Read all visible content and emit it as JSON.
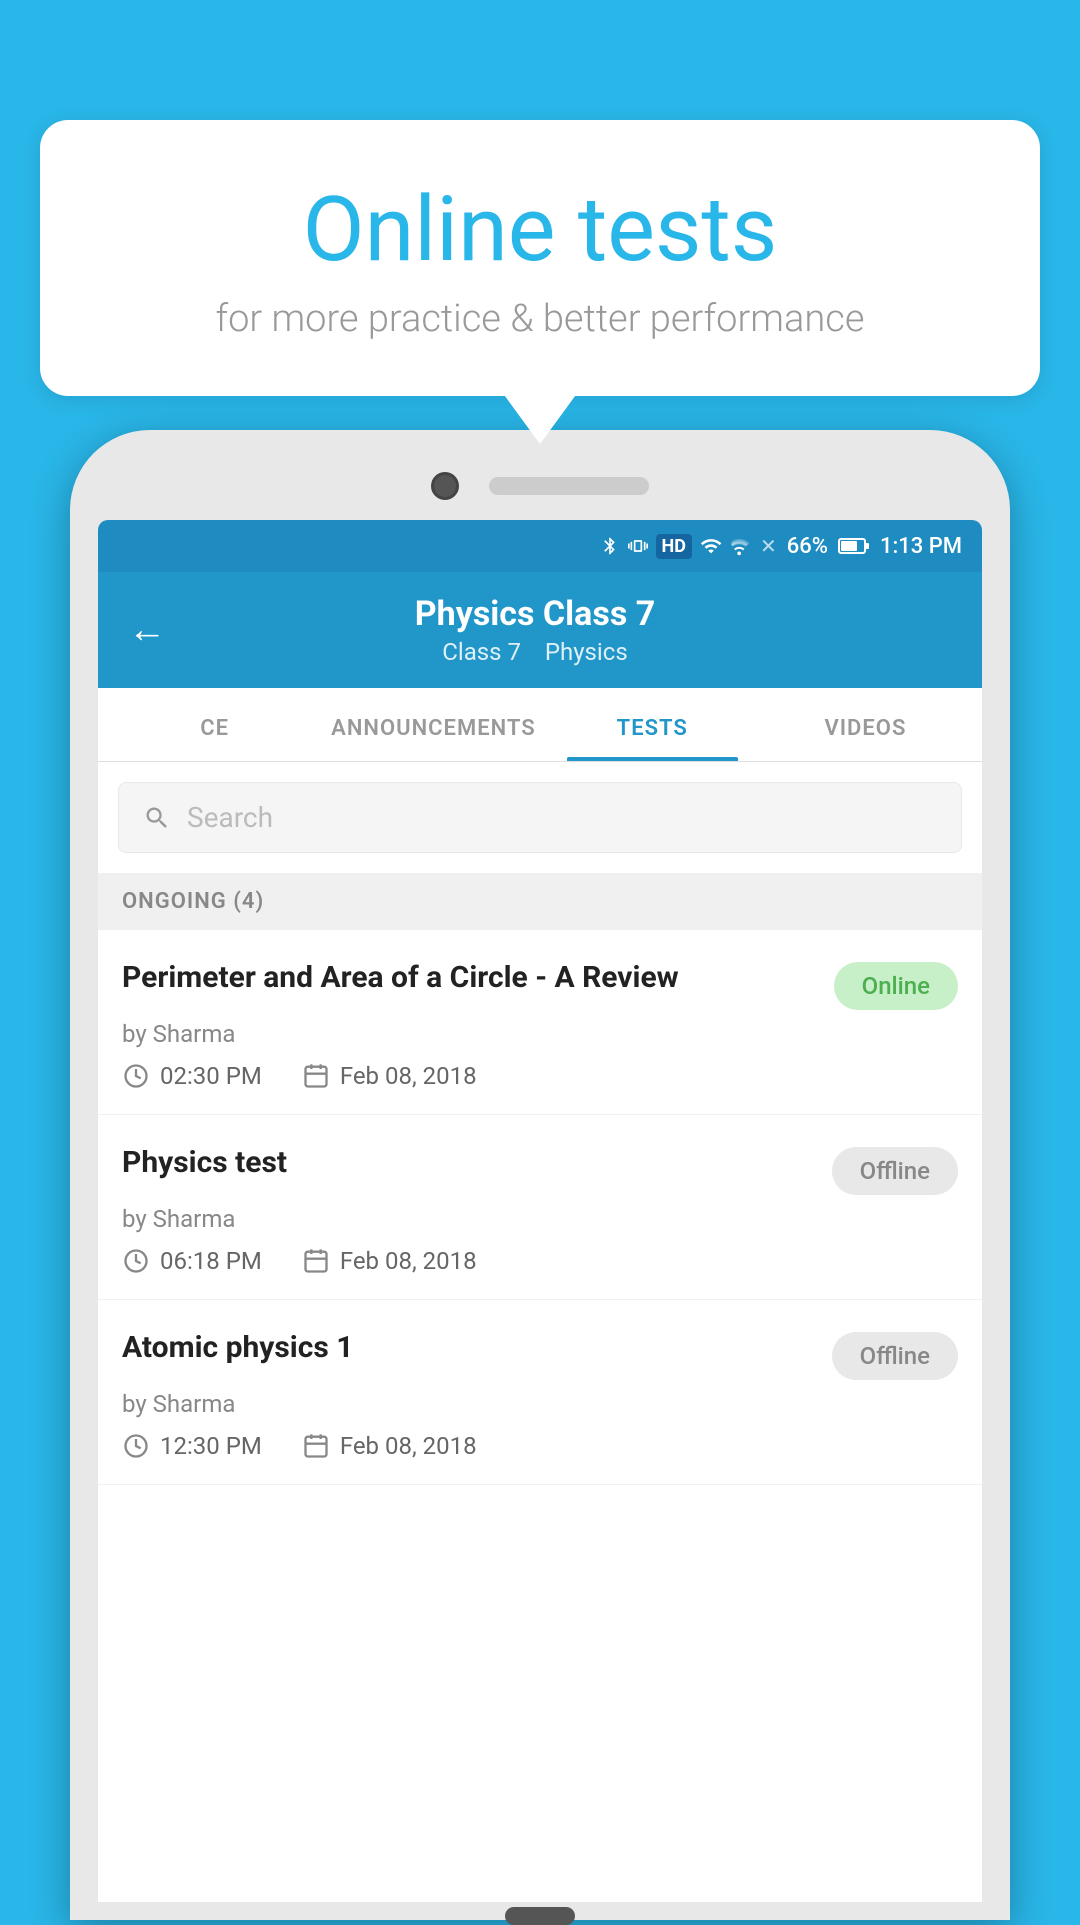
{
  "background_color": "#29b6e8",
  "bubble": {
    "title": "Online tests",
    "subtitle": "for more practice & better performance"
  },
  "status_bar": {
    "battery": "66%",
    "time": "1:13 PM",
    "icons": "bluetooth vibrate hd wifi signal no-sim"
  },
  "header": {
    "back_label": "←",
    "title": "Physics Class 7",
    "subtitle_class": "Class 7",
    "subtitle_subject": "Physics"
  },
  "tabs": [
    {
      "label": "CE",
      "active": false
    },
    {
      "label": "ANNOUNCEMENTS",
      "active": false
    },
    {
      "label": "TESTS",
      "active": true
    },
    {
      "label": "VIDEOS",
      "active": false
    }
  ],
  "search": {
    "placeholder": "Search"
  },
  "section": {
    "label": "ONGOING (4)"
  },
  "tests": [
    {
      "name": "Perimeter and Area of a Circle - A Review",
      "badge": "Online",
      "badge_type": "online",
      "by": "by Sharma",
      "time": "02:30 PM",
      "date": "Feb 08, 2018"
    },
    {
      "name": "Physics test",
      "badge": "Offline",
      "badge_type": "offline",
      "by": "by Sharma",
      "time": "06:18 PM",
      "date": "Feb 08, 2018"
    },
    {
      "name": "Atomic physics 1",
      "badge": "Offline",
      "badge_type": "offline",
      "by": "by Sharma",
      "time": "12:30 PM",
      "date": "Feb 08, 2018"
    }
  ]
}
